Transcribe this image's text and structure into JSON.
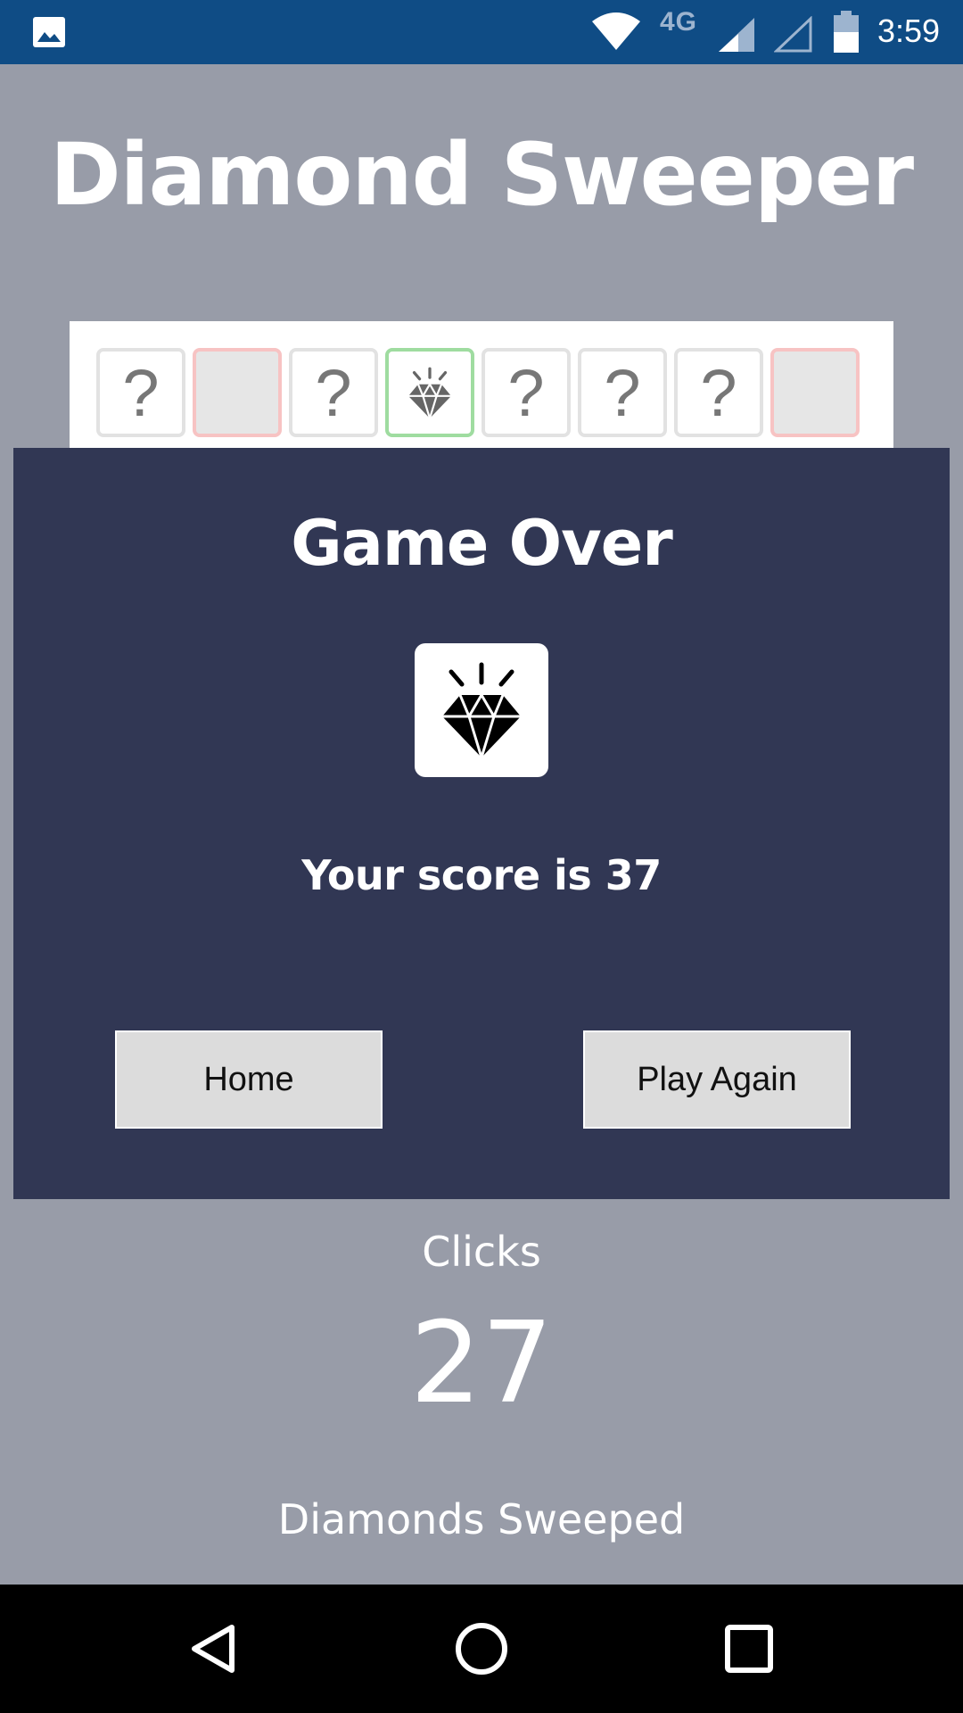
{
  "status_bar": {
    "network": "4G",
    "time": "3:59",
    "icons": [
      "gallery-icon",
      "wifi-icon",
      "signal-icon",
      "signal-empty-icon",
      "battery-icon"
    ]
  },
  "app": {
    "title": "Diamond Sweeper"
  },
  "board": {
    "tiles": [
      {
        "state": "hidden",
        "label": "?"
      },
      {
        "state": "empty",
        "label": ""
      },
      {
        "state": "hidden",
        "label": "?"
      },
      {
        "state": "diamond",
        "label": ""
      },
      {
        "state": "hidden",
        "label": "?"
      },
      {
        "state": "hidden",
        "label": "?"
      },
      {
        "state": "hidden",
        "label": "?"
      },
      {
        "state": "empty",
        "label": ""
      }
    ]
  },
  "modal": {
    "title": "Game Over",
    "score_text": "Your score is 37",
    "home_label": "Home",
    "play_again_label": "Play Again"
  },
  "stats": {
    "clicks_label": "Clicks",
    "clicks_value": "27",
    "diamonds_label": "Diamonds Sweeped"
  },
  "nav": {
    "icons": [
      "back-icon",
      "home-icon",
      "recents-icon"
    ]
  },
  "colors": {
    "status_bar": "#0f4c85",
    "background": "#989ca8",
    "modal": "#313754",
    "button": "#dcdcdc",
    "empty_tile_border": "#f7c3c3",
    "diamond_tile_border": "#9fdca0"
  }
}
